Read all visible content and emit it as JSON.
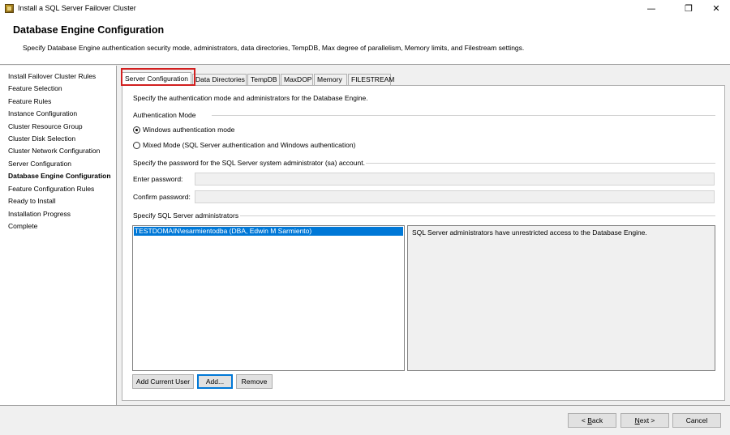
{
  "window": {
    "title": "Install a SQL Server Failover Cluster",
    "minimize": "—",
    "maximize": "❐",
    "close": "✕"
  },
  "header": {
    "title": "Database Engine Configuration",
    "description": "Specify Database Engine authentication security mode, administrators, data directories, TempDB, Max degree of parallelism, Memory limits, and Filestream settings."
  },
  "sidebar": {
    "items": [
      {
        "label": "Install Failover Cluster Rules"
      },
      {
        "label": "Feature Selection"
      },
      {
        "label": "Feature Rules"
      },
      {
        "label": "Instance Configuration"
      },
      {
        "label": "Cluster Resource Group"
      },
      {
        "label": "Cluster Disk Selection"
      },
      {
        "label": "Cluster Network Configuration"
      },
      {
        "label": "Server Configuration"
      },
      {
        "label": "Database Engine Configuration"
      },
      {
        "label": "Feature Configuration Rules"
      },
      {
        "label": "Ready to Install"
      },
      {
        "label": "Installation Progress"
      },
      {
        "label": "Complete"
      }
    ],
    "active_index": 8
  },
  "tabs": [
    {
      "label": "Server Configuration"
    },
    {
      "label": "Data Directories"
    },
    {
      "label": "TempDB"
    },
    {
      "label": "MaxDOP"
    },
    {
      "label": "Memory"
    },
    {
      "label": "FILESTREAM"
    }
  ],
  "server_config": {
    "description": "Specify the authentication mode and administrators for the Database Engine.",
    "auth_group_label": "Authentication Mode",
    "windows_auth_label": "Windows authentication mode",
    "mixed_mode_label": "Mixed Mode (SQL Server authentication and Windows authentication)",
    "selected_mode": "windows",
    "sa_password_desc": "Specify the password for the SQL Server system administrator (sa) account.",
    "enter_password_label": "Enter password:",
    "enter_password_value": "",
    "confirm_password_label": "Confirm password:",
    "confirm_password_value": "",
    "admins_group_label": "Specify SQL Server administrators",
    "admins": [
      "TESTDOMAIN\\esarmientodba (DBA, Edwin M Sarmiento)"
    ],
    "admins_info": "SQL Server administrators have unrestricted access to the Database Engine.",
    "add_current_user_label": "Add Current User",
    "add_label": "Add...",
    "remove_label": "Remove"
  },
  "footer": {
    "back_prefix": "< ",
    "back_mnemonic": "B",
    "back_rest": "ack",
    "next_mnemonic": "N",
    "next_rest": "ext >",
    "cancel_label": "Cancel"
  },
  "colors": {
    "highlight_box": "#d21f1f",
    "selection": "#0078d7"
  }
}
